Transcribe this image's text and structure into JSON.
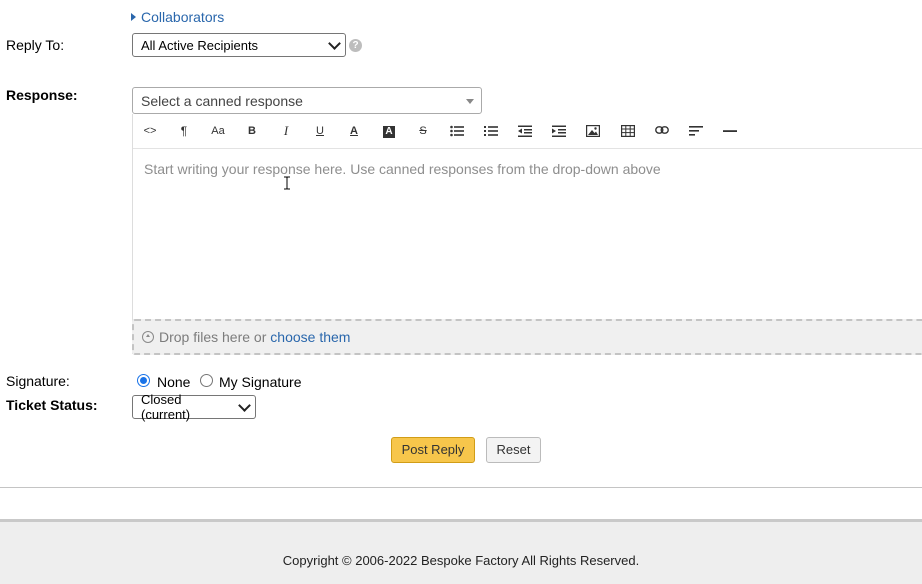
{
  "form": {
    "collaborators_link": "Collaborators",
    "reply_to": {
      "label": "Reply To:",
      "selected": "All Active Recipients",
      "help": "?"
    },
    "response": {
      "label": "Response:",
      "canned_placeholder": "Select a canned response",
      "editor_placeholder": "Start writing your response here. Use canned responses from the drop-down above",
      "toolbar": [
        {
          "name": "html-code",
          "glyph": "<>"
        },
        {
          "name": "formatting",
          "glyph": "¶"
        },
        {
          "name": "font-size",
          "glyph": "Aa"
        },
        {
          "name": "bold",
          "glyph": "B"
        },
        {
          "name": "italic",
          "glyph": "I"
        },
        {
          "name": "underline",
          "glyph": "U"
        },
        {
          "name": "text-color",
          "glyph": "A"
        },
        {
          "name": "background-color",
          "glyph": "A"
        },
        {
          "name": "strikethrough",
          "glyph": "S"
        },
        {
          "name": "unordered-list",
          "glyph": ""
        },
        {
          "name": "ordered-list",
          "glyph": ""
        },
        {
          "name": "outdent",
          "glyph": ""
        },
        {
          "name": "indent",
          "glyph": ""
        },
        {
          "name": "image",
          "glyph": ""
        },
        {
          "name": "table",
          "glyph": ""
        },
        {
          "name": "link",
          "glyph": ""
        },
        {
          "name": "alignment",
          "glyph": ""
        },
        {
          "name": "horizontal-rule",
          "glyph": ""
        }
      ],
      "dropzone_text": "Drop files here or",
      "dropzone_link": "choose them"
    },
    "signature": {
      "label": "Signature:",
      "options": [
        "None",
        "My Signature"
      ],
      "selected": "None"
    },
    "ticket_status": {
      "label": "Ticket Status:",
      "selected": "Closed (current)"
    },
    "buttons": {
      "post": "Post Reply",
      "reset": "Reset"
    }
  },
  "footer": {
    "copyright": "Copyright © 2006-2022 Bespoke Factory All Rights Reserved."
  },
  "colors": {
    "link": "#2a67ac",
    "post_button": "#f7c64b",
    "radio_selected": "#1a73e8"
  }
}
